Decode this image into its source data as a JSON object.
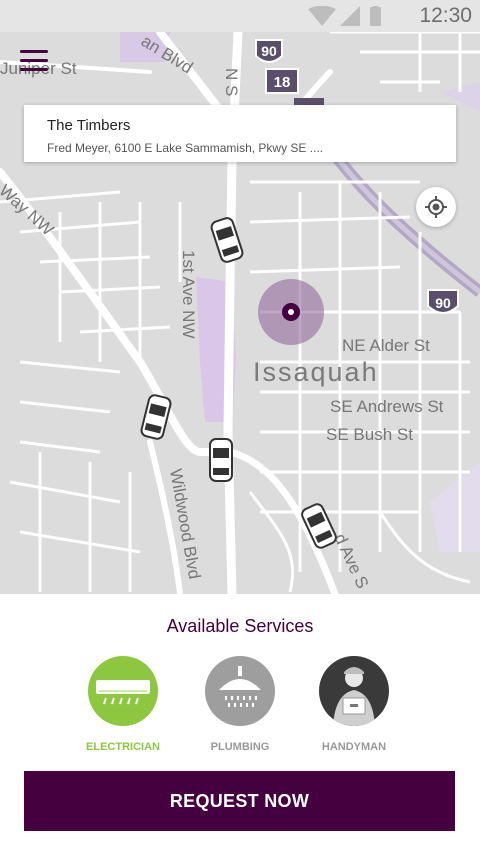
{
  "status_bar": {
    "time": "12:30"
  },
  "map": {
    "city_label": "Issaquah",
    "street_labels": {
      "juniper": "Juniper St",
      "blvd": "an Blvd",
      "nst": "N S",
      "way": "Way NW",
      "first_ave": "1st Ave NW",
      "alder": "NE Alder St",
      "andrews": "SE Andrews St",
      "bush": "SE Bush St",
      "wildwood": "Wildwood Blvd",
      "ave": "d Ave S"
    },
    "shields": {
      "i90_top": "90",
      "route18": "18",
      "route17": "17",
      "i90_right": "90"
    }
  },
  "location_card": {
    "title": "The Timbers",
    "address": "Fred Meyer, 6100 E Lake Sammamish, Pkwy SE ...."
  },
  "bottom_sheet": {
    "heading": "Available Services",
    "services": [
      {
        "label": "ELECTRICIAN",
        "selected": true,
        "color": "#8dc63f"
      },
      {
        "label": "PLUMBING",
        "selected": false,
        "color": "#9e9e9e"
      },
      {
        "label": "HANDYMAN",
        "selected": false,
        "color": "#3a3a3a"
      }
    ],
    "request_button": "REQUEST NOW"
  },
  "colors": {
    "brand": "#44003f",
    "accent_green": "#8dc63f",
    "map_bg": "#dcdcdc"
  }
}
